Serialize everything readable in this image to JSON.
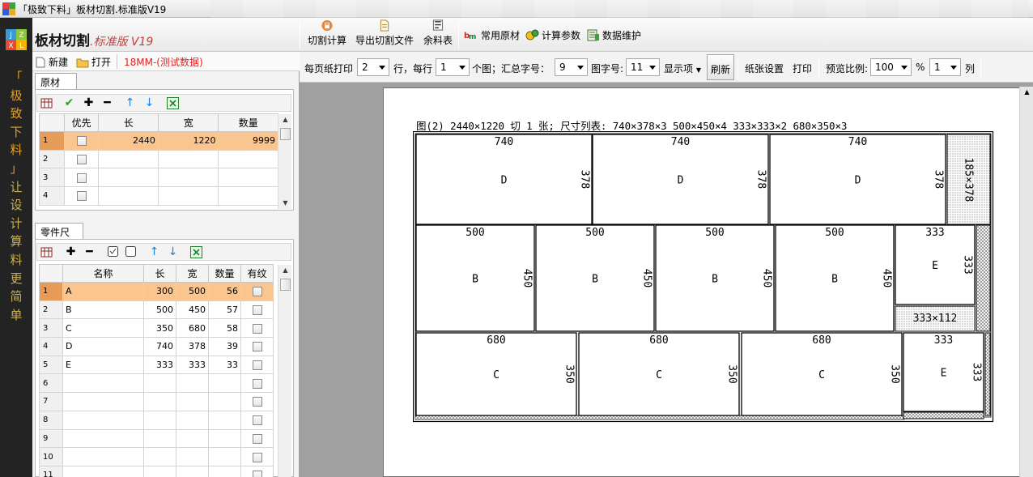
{
  "window": {
    "title": "「极致下料」板材切割.标准版V19"
  },
  "slogan": [
    "「",
    "极",
    "致",
    "下",
    "料",
    "」",
    "让",
    "设",
    "计",
    "算",
    "料",
    "更",
    "简",
    "单"
  ],
  "slogan_colors": {
    "brand": "#e8a020",
    "rest": "#c8b050"
  },
  "brand": {
    "name": "板材切割",
    "edition": ".标准版 V19"
  },
  "toolbar": {
    "cut": "切割计算",
    "export": "导出切割文件",
    "remnant": "余料表",
    "common_material": "常用原材",
    "calc_params": "计算参数",
    "data_maint": "数据维护"
  },
  "file": {
    "new": "新建",
    "open": "打开",
    "dataset": "18MM-(测试数据)"
  },
  "raw_material": {
    "tab": "原材",
    "headers": [
      "优先",
      "长",
      "宽",
      "数量"
    ],
    "rows": [
      {
        "n": "1",
        "pri": false,
        "len": "2440",
        "wid": "1220",
        "qty": "9999"
      },
      {
        "n": "2",
        "pri": false,
        "len": "",
        "wid": "",
        "qty": ""
      },
      {
        "n": "3",
        "pri": false,
        "len": "",
        "wid": "",
        "qty": ""
      },
      {
        "n": "4",
        "pri": false,
        "len": "",
        "wid": "",
        "qty": ""
      }
    ]
  },
  "parts": {
    "tab": "零件尺寸",
    "headers": [
      "名称",
      "长",
      "宽",
      "数量",
      "有纹"
    ],
    "rows": [
      {
        "n": "1",
        "name": "A",
        "len": "300",
        "wid": "500",
        "qty": "56"
      },
      {
        "n": "2",
        "name": "B",
        "len": "500",
        "wid": "450",
        "qty": "57"
      },
      {
        "n": "3",
        "name": "C",
        "len": "350",
        "wid": "680",
        "qty": "58"
      },
      {
        "n": "4",
        "name": "D",
        "len": "740",
        "wid": "378",
        "qty": "39"
      },
      {
        "n": "5",
        "name": "E",
        "len": "333",
        "wid": "333",
        "qty": "33"
      },
      {
        "n": "6",
        "name": "",
        "len": "",
        "wid": "",
        "qty": ""
      },
      {
        "n": "7",
        "name": "",
        "len": "",
        "wid": "",
        "qty": ""
      },
      {
        "n": "8",
        "name": "",
        "len": "",
        "wid": "",
        "qty": ""
      },
      {
        "n": "9",
        "name": "",
        "len": "",
        "wid": "",
        "qty": ""
      },
      {
        "n": "10",
        "name": "",
        "len": "",
        "wid": "",
        "qty": ""
      },
      {
        "n": "11",
        "name": "",
        "len": "",
        "wid": "",
        "qty": ""
      }
    ]
  },
  "options": {
    "sheets_per_page_label": "每页纸打印",
    "sheets_per_page": "2",
    "rows_label": "行，每行",
    "per_row": "1",
    "count_label": "个图；汇总字号：",
    "summary_font": "9",
    "font_label": "图字号:",
    "figure_font": "11",
    "display_label": "显示项",
    "refresh": "刷新",
    "paper_setup": "纸张设置",
    "print": "打印",
    "scale_label": "预览比例:",
    "scale": "100",
    "percent": "%",
    "cols": "1",
    "cols_label": "列"
  },
  "preview": {
    "caption": "图(2) 2440×1220 切 1 张; 尺寸列表: 740×378×3 500×450×4 333×333×2 680×350×3",
    "pieces": [
      {
        "w": "740",
        "h": "378",
        "id": "D"
      },
      {
        "w": "740",
        "h": "378",
        "id": "D"
      },
      {
        "w": "740",
        "h": "378",
        "id": "D"
      },
      {
        "w": "500",
        "h": "450",
        "id": "B"
      },
      {
        "w": "500",
        "h": "450",
        "id": "B"
      },
      {
        "w": "500",
        "h": "450",
        "id": "B"
      },
      {
        "w": "500",
        "h": "450",
        "id": "B"
      },
      {
        "w": "333",
        "h": "333",
        "id": "E"
      },
      {
        "w": "680",
        "h": "350",
        "id": "C"
      },
      {
        "w": "680",
        "h": "350",
        "id": "C"
      },
      {
        "w": "680",
        "h": "350",
        "id": "C"
      },
      {
        "w": "333",
        "h": "333",
        "id": "E"
      }
    ],
    "remnants": [
      "185×378",
      "333×112"
    ]
  }
}
